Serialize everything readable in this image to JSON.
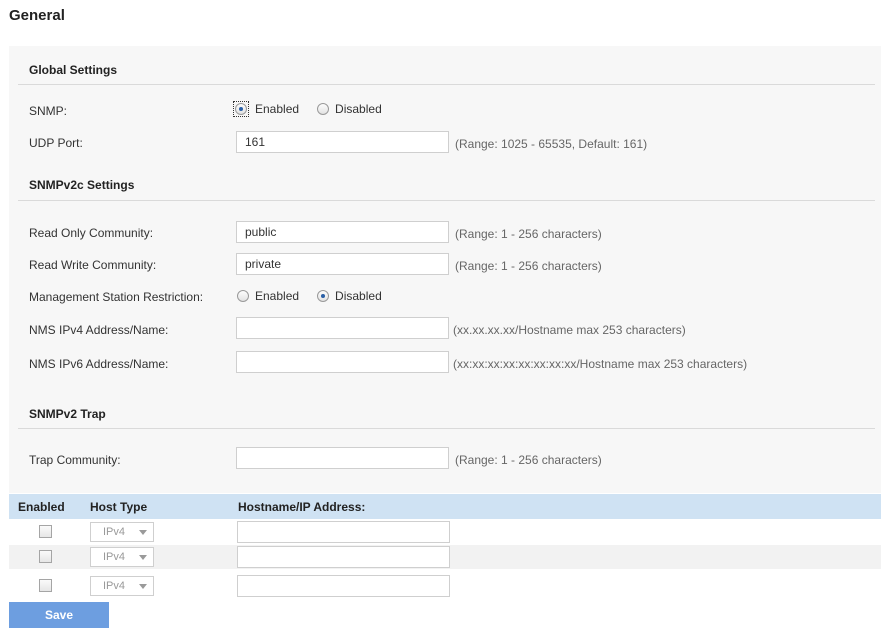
{
  "page": {
    "title": "General"
  },
  "global": {
    "title": "Global Settings",
    "snmp": {
      "label": "SNMP:",
      "opt_enabled": "Enabled",
      "opt_disabled": "Disabled",
      "selected": "Enabled"
    },
    "udp": {
      "label": "UDP Port:",
      "value": "161",
      "hint": "(Range: 1025 - 65535, Default: 161)"
    }
  },
  "v2c": {
    "title": "SNMPv2c Settings",
    "read_only": {
      "label": "Read Only Community:",
      "value": "public",
      "hint": "(Range: 1 - 256 characters)"
    },
    "read_write": {
      "label": "Read Write Community:",
      "value": "private",
      "hint": "(Range: 1 - 256 characters)"
    },
    "restriction": {
      "label": "Management Station Restriction:",
      "opt_enabled": "Enabled",
      "opt_disabled": "Disabled",
      "selected": "Disabled"
    },
    "nms_v4": {
      "label": "NMS IPv4 Address/Name:",
      "value": "",
      "hint": "(xx.xx.xx.xx/Hostname max 253 characters)"
    },
    "nms_v6": {
      "label": "NMS IPv6 Address/Name:",
      "value": "",
      "hint": "(xx:xx:xx:xx:xx:xx:xx:xx/Hostname max 253 characters)"
    }
  },
  "trap": {
    "title": "SNMPv2 Trap",
    "community": {
      "label": "Trap Community:",
      "value": "",
      "hint": "(Range: 1 - 256 characters)"
    }
  },
  "hosts_table": {
    "columns": [
      "Enabled",
      "Host Type",
      "Hostname/IP Address:"
    ],
    "rows": [
      {
        "enabled": false,
        "host_type": "IPv4",
        "address": ""
      },
      {
        "enabled": false,
        "host_type": "IPv4",
        "address": ""
      },
      {
        "enabled": false,
        "host_type": "IPv4",
        "address": ""
      }
    ]
  },
  "actions": {
    "save_label": "Save"
  },
  "colors": {
    "accent": "#6d9ee0",
    "table_header": "#cfe2f3",
    "panel_bg": "#f7f7f7"
  }
}
